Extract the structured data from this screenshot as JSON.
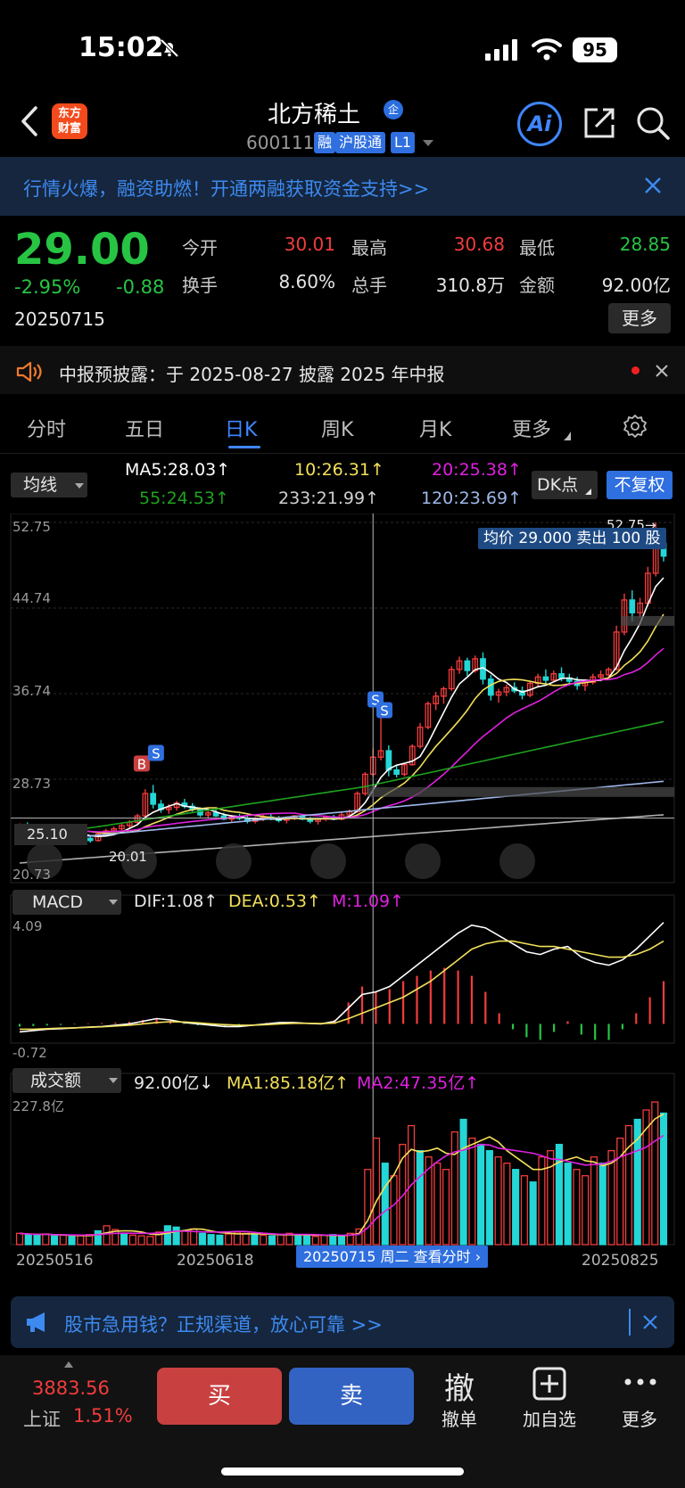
{
  "status": {
    "time": "15:02",
    "battery": "95"
  },
  "header": {
    "logo_line1": "东方",
    "logo_line2": "财富",
    "stock_name": "北方稀土",
    "qi_badge": "企",
    "stock_code": "600111",
    "badges": [
      "融",
      "沪股通",
      "L1"
    ]
  },
  "promo": {
    "text": "行情火爆，融资助燃！开通两融获取资金支持>>"
  },
  "quote": {
    "price": "29.00",
    "change_pct": "-2.95%",
    "change_abs": "-0.88",
    "date": "20250715",
    "fields": [
      {
        "label": "今开",
        "value": "30.01",
        "color": "red"
      },
      {
        "label": "最高",
        "value": "30.68",
        "color": "red"
      },
      {
        "label": "最低",
        "value": "28.85",
        "color": "green"
      },
      {
        "label": "换手",
        "value": "8.60%",
        "color": "white"
      },
      {
        "label": "总手",
        "value": "310.8万",
        "color": "white"
      },
      {
        "label": "金额",
        "value": "92.00亿",
        "color": "white"
      }
    ],
    "more": "更多"
  },
  "notice": {
    "text": "中报预披露：于 2025-08-27 披露 2025 年中报"
  },
  "tabs": [
    {
      "label": "分时"
    },
    {
      "label": "五日"
    },
    {
      "label": "日K"
    },
    {
      "label": "周K"
    },
    {
      "label": "月K"
    },
    {
      "label": "更多"
    }
  ],
  "ma_panel": {
    "selector": "均线",
    "ma5": "MA5:28.03",
    "ma10": "10:26.31",
    "ma20": "20:25.38",
    "ma55": "55:24.53",
    "ma233": "233:21.99",
    "ma120": "120:23.69",
    "dk": "DK点",
    "adjust": "不复权"
  },
  "colors": {
    "up": "#f23c3c",
    "down": "#27c444",
    "ma5": "#ffffff",
    "ma10": "#f2e05a",
    "ma20": "#e020e0",
    "ma55": "#1fa21f",
    "ma120": "#9fb8ea",
    "ma233": "#b0b0b0",
    "accent": "#3f86ff"
  },
  "kline": {
    "y_labels": [
      "52.75",
      "44.74",
      "36.74",
      "28.73",
      "20.73"
    ],
    "high_marker": "52.75→",
    "low_marker": "20.01",
    "tip": "均价 29.000 卖出 100 股",
    "cross_price": "25.10"
  },
  "macd": {
    "selector": "MACD",
    "dif": "DIF:1.08",
    "dea": "DEA:0.53",
    "m": "M:1.09",
    "y_top": "4.09",
    "y_bottom": "-0.72"
  },
  "volume": {
    "selector": "成交额",
    "value": "92.00亿",
    "ma1": "MA1:85.18亿",
    "ma2": "MA2:47.35亿",
    "y_top": "227.8亿"
  },
  "x_axis": {
    "dates": [
      "20250516",
      "20250618",
      "20250825"
    ],
    "tip": "20250715 周二 查看分时"
  },
  "loan_banner": {
    "text": "股市急用钱？正规渠道，放心可靠 >>"
  },
  "bottom": {
    "index_value": "3883.56",
    "index_name": "上证",
    "index_pct": "1.51%",
    "buy": "买",
    "sell": "卖",
    "cancel_glyph": "撤",
    "cancel": "撤单",
    "add_watch": "加自选",
    "more": "更多"
  },
  "chart_data": {
    "type": "candlestick",
    "period": "日K",
    "ylim": [
      20.73,
      52.75
    ],
    "candles": [
      [
        24.4,
        24.6,
        24.2,
        24.5
      ],
      [
        24.5,
        24.7,
        24.3,
        24.4
      ],
      [
        24.4,
        24.5,
        24.0,
        24.2
      ],
      [
        24.2,
        24.4,
        23.9,
        24.1
      ],
      [
        24.1,
        24.3,
        23.8,
        23.9
      ],
      [
        23.9,
        24.2,
        23.7,
        24.0
      ],
      [
        24.0,
        24.1,
        23.5,
        23.7
      ],
      [
        23.7,
        23.9,
        23.2,
        23.4
      ],
      [
        23.4,
        23.6,
        23.0,
        23.2
      ],
      [
        23.2,
        23.4,
        22.8,
        23.0
      ],
      [
        23.0,
        23.8,
        22.9,
        23.6
      ],
      [
        23.6,
        24.1,
        23.4,
        23.9
      ],
      [
        23.9,
        24.3,
        23.6,
        24.1
      ],
      [
        24.1,
        24.6,
        23.9,
        24.4
      ],
      [
        24.4,
        24.9,
        24.2,
        24.7
      ],
      [
        24.7,
        25.5,
        24.5,
        25.3
      ],
      [
        25.3,
        27.8,
        25.0,
        27.4
      ],
      [
        27.4,
        28.2,
        26.0,
        26.4
      ],
      [
        26.4,
        26.8,
        25.6,
        25.9
      ],
      [
        25.9,
        26.4,
        25.5,
        26.1
      ],
      [
        26.1,
        26.7,
        25.8,
        26.5
      ],
      [
        26.5,
        26.9,
        26.0,
        26.2
      ],
      [
        26.2,
        26.5,
        25.7,
        25.9
      ],
      [
        25.9,
        26.1,
        25.2,
        25.4
      ],
      [
        25.4,
        25.8,
        25.1,
        25.6
      ],
      [
        25.6,
        25.9,
        25.2,
        25.3
      ],
      [
        25.3,
        25.6,
        24.9,
        25.0
      ],
      [
        25.0,
        25.4,
        24.7,
        25.2
      ],
      [
        25.2,
        25.5,
        24.9,
        25.1
      ],
      [
        25.1,
        25.3,
        24.6,
        24.8
      ],
      [
        24.8,
        25.2,
        24.6,
        25.0
      ],
      [
        25.0,
        25.4,
        24.8,
        25.2
      ],
      [
        25.2,
        25.5,
        24.9,
        25.0
      ],
      [
        25.0,
        25.3,
        24.7,
        24.9
      ],
      [
        24.9,
        25.2,
        24.6,
        25.1
      ],
      [
        25.1,
        25.4,
        24.9,
        25.3
      ],
      [
        25.3,
        25.5,
        24.9,
        25.0
      ],
      [
        25.0,
        25.2,
        24.6,
        24.8
      ],
      [
        24.8,
        25.1,
        24.5,
        25.0
      ],
      [
        25.0,
        25.3,
        24.8,
        25.2
      ],
      [
        25.2,
        25.4,
        24.9,
        25.0
      ],
      [
        25.0,
        25.6,
        24.9,
        25.4
      ],
      [
        25.4,
        25.9,
        25.2,
        25.7
      ],
      [
        25.7,
        27.6,
        25.6,
        27.4
      ],
      [
        27.4,
        29.4,
        27.2,
        29.2
      ],
      [
        29.2,
        31.6,
        29.0,
        30.8
      ],
      [
        30.8,
        34.6,
        30.5,
        31.4
      ],
      [
        31.4,
        31.9,
        29.0,
        29.6
      ],
      [
        29.6,
        30.0,
        28.9,
        29.2
      ],
      [
        29.2,
        30.2,
        29.0,
        30.1
      ],
      [
        30.1,
        32.0,
        30.0,
        31.8
      ],
      [
        31.8,
        34.0,
        31.6,
        33.6
      ],
      [
        33.6,
        36.0,
        33.4,
        35.8
      ],
      [
        35.8,
        36.9,
        35.2,
        36.5
      ],
      [
        36.5,
        37.4,
        35.8,
        37.2
      ],
      [
        37.2,
        39.3,
        37.0,
        39.0
      ],
      [
        39.0,
        40.2,
        38.6,
        39.8
      ],
      [
        39.8,
        40.1,
        38.4,
        38.9
      ],
      [
        38.9,
        40.3,
        38.7,
        40.0
      ],
      [
        40.0,
        40.6,
        37.6,
        38.1
      ],
      [
        38.1,
        38.5,
        36.1,
        36.6
      ],
      [
        36.6,
        37.2,
        35.9,
        36.9
      ],
      [
        36.9,
        37.6,
        36.5,
        37.3
      ],
      [
        37.3,
        37.8,
        36.8,
        37.0
      ],
      [
        37.0,
        37.4,
        36.2,
        36.6
      ],
      [
        36.6,
        37.9,
        36.4,
        37.7
      ],
      [
        37.7,
        38.6,
        37.3,
        38.3
      ],
      [
        38.3,
        39.0,
        37.6,
        38.0
      ],
      [
        38.0,
        38.9,
        37.8,
        38.6
      ],
      [
        38.6,
        39.2,
        37.9,
        38.2
      ],
      [
        38.2,
        38.6,
        37.5,
        37.9
      ],
      [
        37.9,
        38.3,
        37.1,
        37.5
      ],
      [
        37.5,
        38.1,
        37.0,
        37.8
      ],
      [
        37.8,
        38.6,
        37.6,
        38.3
      ],
      [
        38.3,
        38.9,
        37.9,
        38.5
      ],
      [
        38.5,
        39.2,
        38.3,
        39.0
      ],
      [
        39.0,
        43.1,
        38.9,
        42.5
      ],
      [
        42.5,
        46.1,
        42.2,
        45.5
      ],
      [
        45.5,
        46.4,
        43.5,
        44.3
      ],
      [
        44.3,
        45.7,
        43.8,
        45.2
      ],
      [
        45.2,
        48.6,
        44.9,
        48.0
      ],
      [
        48.0,
        52.75,
        47.7,
        50.8
      ],
      [
        50.8,
        52.2,
        49.1,
        49.6
      ]
    ],
    "macd": {
      "ylim": [
        -0.72,
        4.09
      ],
      "dif": [
        -0.3,
        -0.25,
        -0.2,
        -0.18,
        -0.15,
        -0.12,
        -0.1,
        -0.05,
        0.0,
        0.1,
        0.2,
        0.15,
        0.05,
        0.0,
        -0.05,
        -0.1,
        -0.1,
        -0.05,
        0.0,
        0.05,
        0.05,
        0.02,
        0.0,
        0.1,
        0.6,
        1.1,
        1.2,
        1.4,
        1.8,
        2.2,
        2.6,
        3.0,
        3.4,
        3.7,
        3.6,
        3.3,
        3.0,
        2.7,
        2.6,
        2.8,
        2.9,
        2.5,
        2.3,
        2.2,
        2.4,
        2.8,
        3.3,
        3.8
      ],
      "dea": [
        -0.2,
        -0.2,
        -0.18,
        -0.16,
        -0.15,
        -0.13,
        -0.11,
        -0.08,
        -0.05,
        0.0,
        0.05,
        0.08,
        0.07,
        0.04,
        0.0,
        -0.03,
        -0.05,
        -0.05,
        -0.03,
        0.0,
        0.02,
        0.02,
        0.01,
        0.03,
        0.2,
        0.4,
        0.6,
        0.8,
        1.0,
        1.3,
        1.6,
        2.0,
        2.4,
        2.8,
        3.0,
        3.1,
        3.1,
        3.0,
        2.9,
        2.9,
        2.8,
        2.7,
        2.6,
        2.5,
        2.5,
        2.6,
        2.8,
        3.1
      ],
      "m": [
        -0.1,
        -0.08,
        -0.06,
        -0.04,
        -0.02,
        0.02,
        0.03,
        0.05,
        0.08,
        0.15,
        0.2,
        0.12,
        -0.02,
        -0.05,
        -0.08,
        -0.1,
        -0.06,
        0.0,
        0.04,
        0.06,
        0.04,
        0.0,
        -0.02,
        0.15,
        0.8,
        1.4,
        1.2,
        1.3,
        1.6,
        1.8,
        2.0,
        2.1,
        2.0,
        1.8,
        1.2,
        0.4,
        -0.2,
        -0.5,
        -0.6,
        -0.3,
        0.1,
        -0.4,
        -0.6,
        -0.6,
        -0.2,
        0.4,
        1.0,
        1.6
      ]
    },
    "volume": {
      "ylim": [
        0,
        227.8
      ],
      "values": [
        18,
        16,
        15,
        17,
        14,
        15,
        13,
        14,
        16,
        22,
        30,
        24,
        18,
        15,
        14,
        13,
        20,
        30,
        28,
        22,
        25,
        18,
        16,
        15,
        17,
        20,
        18,
        16,
        15,
        14,
        16,
        18,
        15,
        14,
        13,
        15,
        16,
        14,
        18,
        25,
        120,
        170,
        130,
        110,
        160,
        190,
        150,
        140,
        130,
        120,
        180,
        200,
        170,
        160,
        150,
        140,
        130,
        120,
        110,
        100,
        140,
        150,
        160,
        130,
        120,
        110,
        140,
        130,
        150,
        170,
        190,
        200,
        215,
        227.8,
        210
      ],
      "up": [
        1,
        0,
        0,
        1,
        0,
        1,
        0,
        1,
        1,
        0,
        1,
        1,
        0,
        1,
        1,
        1,
        1,
        0,
        0,
        1,
        1,
        0,
        0,
        0,
        1,
        1,
        1,
        0,
        1,
        0,
        1,
        1,
        0,
        0,
        1,
        1,
        0,
        0,
        1,
        1,
        1,
        1,
        0,
        1,
        1,
        1,
        0,
        1,
        1,
        1,
        1,
        0,
        1,
        0,
        0,
        1,
        1,
        0,
        1,
        0,
        1,
        1,
        0,
        0,
        1,
        1,
        1,
        0,
        1,
        1,
        1,
        0,
        1,
        1,
        0
      ]
    }
  }
}
